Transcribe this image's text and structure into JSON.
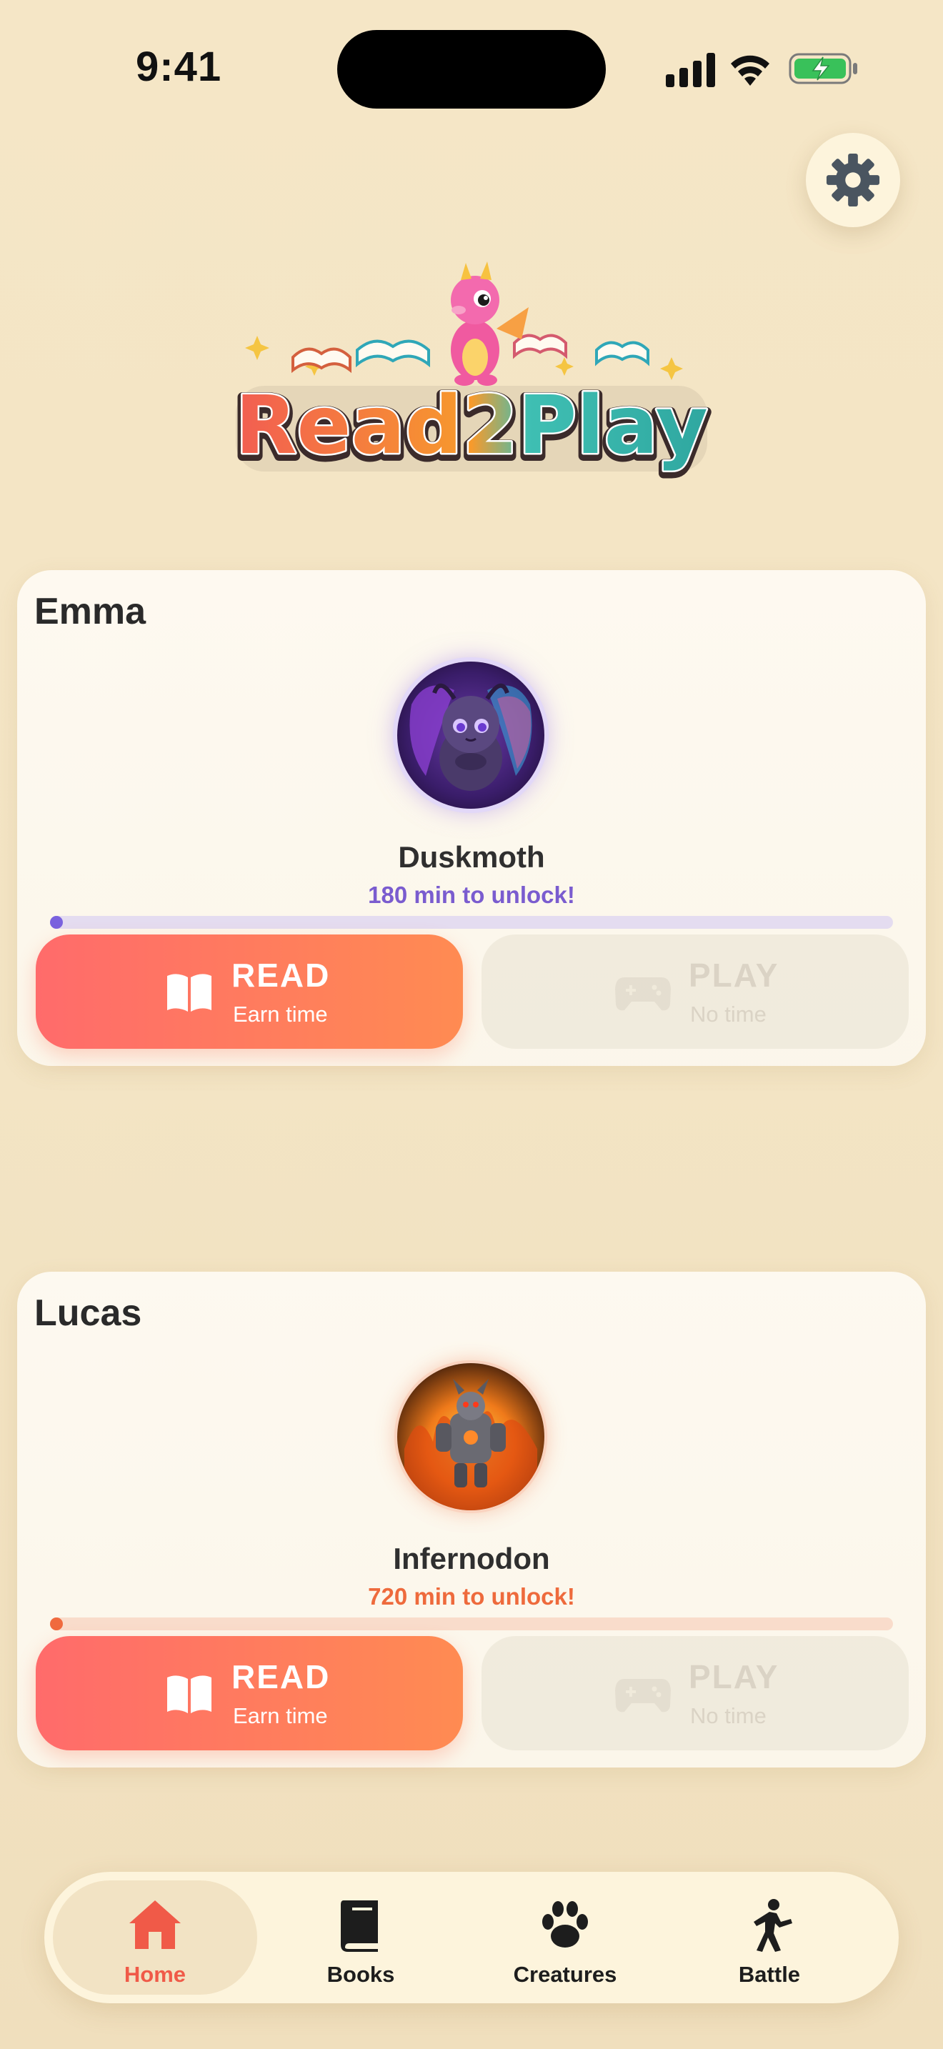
{
  "status_bar": {
    "time": "9:41"
  },
  "app": {
    "name": "Read2Play"
  },
  "children": [
    {
      "name": "Emma",
      "creature_name": "Duskmoth",
      "unlock_text": "180 min to unlock!",
      "progress": 0.01,
      "read_label": "READ",
      "read_sub": "Earn time",
      "play_label": "PLAY",
      "play_sub": "No time"
    },
    {
      "name": "Lucas",
      "creature_name": "Infernodon",
      "unlock_text": "720 min to unlock!",
      "progress": 0.01,
      "read_label": "READ",
      "read_sub": "Earn time",
      "play_label": "PLAY",
      "play_sub": "No time"
    }
  ],
  "tabs": [
    {
      "label": "Home",
      "icon": "home-icon",
      "active": true
    },
    {
      "label": "Books",
      "icon": "book-icon",
      "active": false
    },
    {
      "label": "Creatures",
      "icon": "paw-icon",
      "active": false
    },
    {
      "label": "Battle",
      "icon": "fighter-icon",
      "active": false
    }
  ],
  "colors": {
    "accent": "#ff6b6b",
    "accent_end": "#ff8b52",
    "emma_progress": "#7a62de",
    "lucas_progress": "#f06a3e",
    "active_tab": "#f05a48"
  }
}
